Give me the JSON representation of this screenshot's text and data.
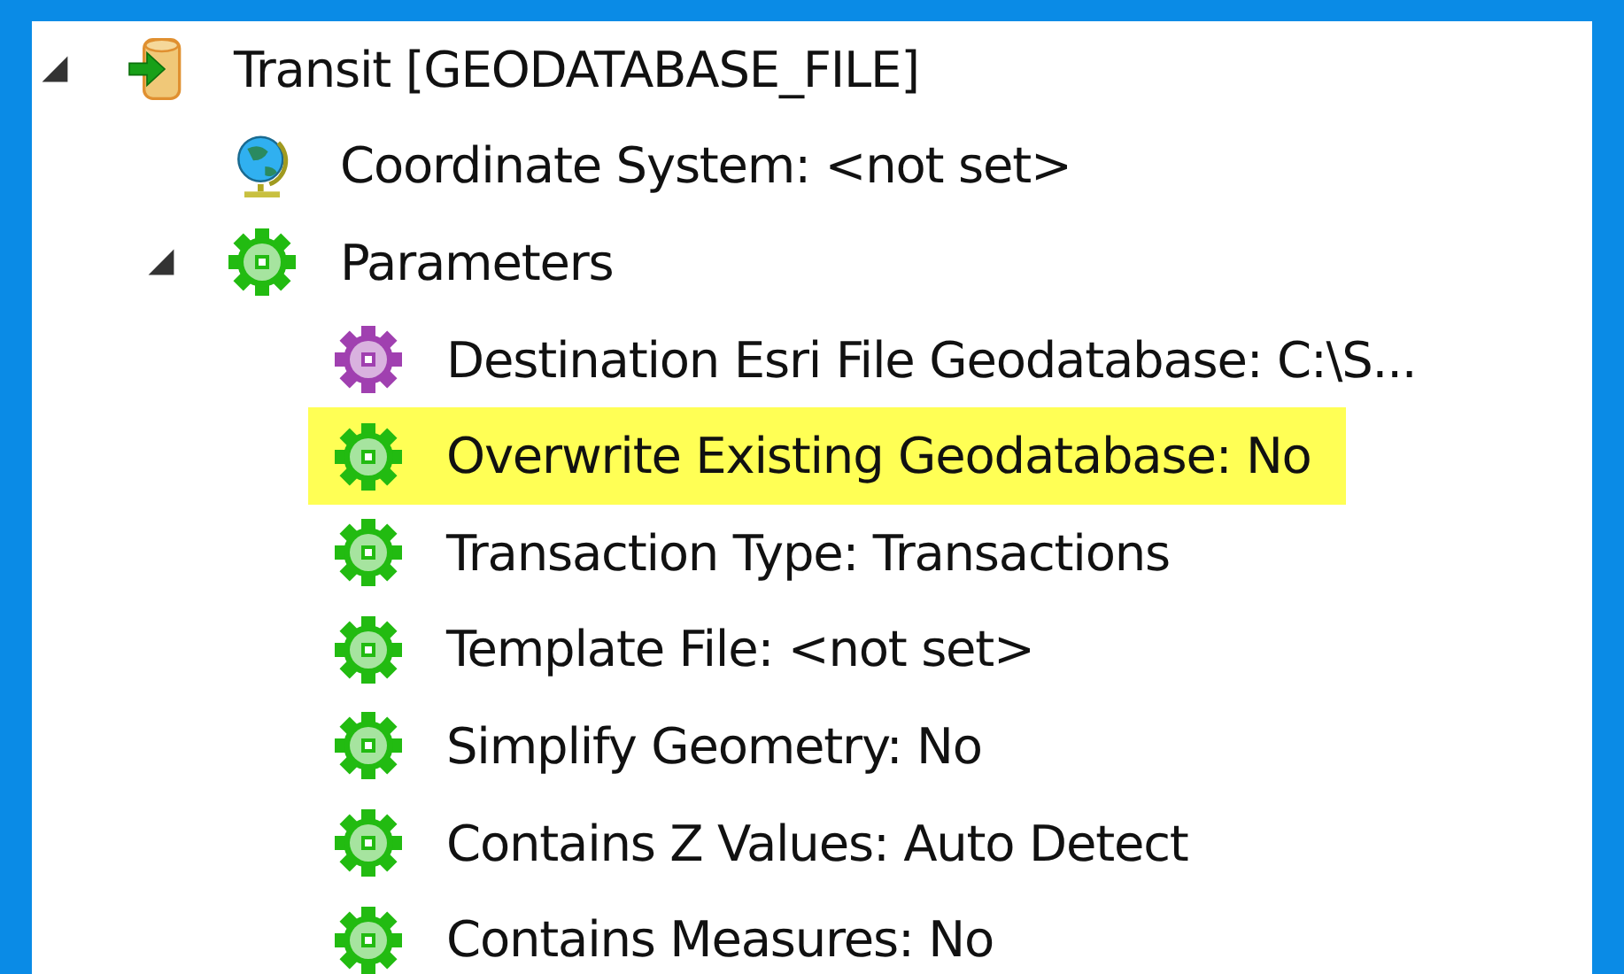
{
  "tree": [
    {
      "label": "Transit [GEODATABASE_FILE]",
      "kind": "database",
      "expanded": true,
      "selected": false,
      "children": [
        {
          "label": "Coordinate System: <not set>",
          "kind": "globe",
          "selected": false
        },
        {
          "label": "Parameters",
          "kind": "gear",
          "color": "#22bb11",
          "expanded": true,
          "selected": false,
          "children": [
            {
              "label": "Destination Esri File Geodatabase: C:\\S...",
              "kind": "gear",
              "color": "#a040b0",
              "selected": false
            },
            {
              "label": "Overwrite Existing Geodatabase: No",
              "kind": "gear",
              "color": "#22bb11",
              "selected": true
            },
            {
              "label": "Transaction Type: Transactions",
              "kind": "gear",
              "color": "#22bb11",
              "selected": false
            },
            {
              "label": "Template File: <not set>",
              "kind": "gear",
              "color": "#22bb11",
              "selected": false
            },
            {
              "label": "Simplify Geometry: No",
              "kind": "gear",
              "color": "#22bb11",
              "selected": false
            },
            {
              "label": "Contains Z Values: Auto Detect",
              "kind": "gear",
              "color": "#22bb11",
              "selected": false
            },
            {
              "label": "Contains Measures: No",
              "kind": "gear",
              "color": "#22bb11",
              "selected": false
            }
          ]
        }
      ]
    }
  ]
}
